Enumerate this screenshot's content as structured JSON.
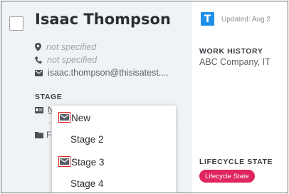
{
  "contact": {
    "name": "Isaac Thompson",
    "location": "not specified",
    "phone": "not specified",
    "email": "isaac.thompson@thisisatest...."
  },
  "stage": {
    "label": "STAGE",
    "current_initial": "N",
    "folder_partial": "Fo"
  },
  "dropdown": {
    "options": [
      "New",
      "Stage 2",
      "Stage 3",
      "Stage 4"
    ]
  },
  "right_panel": {
    "logo_letter": "T",
    "updated": "Updated: Aug 2",
    "work_history_label": "WORK HISTORY",
    "work_history_value": "ABC Company, IT",
    "lifecycle_label": "LIFECYCLE STATE",
    "lifecycle_badge": "Lifecycle State"
  },
  "colors": {
    "left_bg": "#f0f3f6",
    "logo_blue": "#1f8ee8",
    "badge_pink": "#e0245e",
    "highlight_red": "#e02424"
  }
}
